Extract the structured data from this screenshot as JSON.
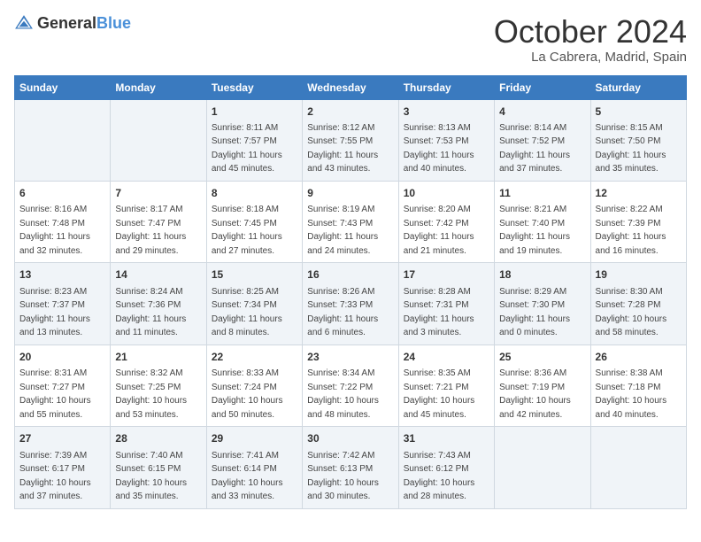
{
  "header": {
    "logo_general": "General",
    "logo_blue": "Blue",
    "month": "October 2024",
    "location": "La Cabrera, Madrid, Spain"
  },
  "columns": [
    "Sunday",
    "Monday",
    "Tuesday",
    "Wednesday",
    "Thursday",
    "Friday",
    "Saturday"
  ],
  "weeks": [
    [
      {
        "day": "",
        "detail": ""
      },
      {
        "day": "",
        "detail": ""
      },
      {
        "day": "1",
        "detail": "Sunrise: 8:11 AM\nSunset: 7:57 PM\nDaylight: 11 hours and 45 minutes."
      },
      {
        "day": "2",
        "detail": "Sunrise: 8:12 AM\nSunset: 7:55 PM\nDaylight: 11 hours and 43 minutes."
      },
      {
        "day": "3",
        "detail": "Sunrise: 8:13 AM\nSunset: 7:53 PM\nDaylight: 11 hours and 40 minutes."
      },
      {
        "day": "4",
        "detail": "Sunrise: 8:14 AM\nSunset: 7:52 PM\nDaylight: 11 hours and 37 minutes."
      },
      {
        "day": "5",
        "detail": "Sunrise: 8:15 AM\nSunset: 7:50 PM\nDaylight: 11 hours and 35 minutes."
      }
    ],
    [
      {
        "day": "6",
        "detail": "Sunrise: 8:16 AM\nSunset: 7:48 PM\nDaylight: 11 hours and 32 minutes."
      },
      {
        "day": "7",
        "detail": "Sunrise: 8:17 AM\nSunset: 7:47 PM\nDaylight: 11 hours and 29 minutes."
      },
      {
        "day": "8",
        "detail": "Sunrise: 8:18 AM\nSunset: 7:45 PM\nDaylight: 11 hours and 27 minutes."
      },
      {
        "day": "9",
        "detail": "Sunrise: 8:19 AM\nSunset: 7:43 PM\nDaylight: 11 hours and 24 minutes."
      },
      {
        "day": "10",
        "detail": "Sunrise: 8:20 AM\nSunset: 7:42 PM\nDaylight: 11 hours and 21 minutes."
      },
      {
        "day": "11",
        "detail": "Sunrise: 8:21 AM\nSunset: 7:40 PM\nDaylight: 11 hours and 19 minutes."
      },
      {
        "day": "12",
        "detail": "Sunrise: 8:22 AM\nSunset: 7:39 PM\nDaylight: 11 hours and 16 minutes."
      }
    ],
    [
      {
        "day": "13",
        "detail": "Sunrise: 8:23 AM\nSunset: 7:37 PM\nDaylight: 11 hours and 13 minutes."
      },
      {
        "day": "14",
        "detail": "Sunrise: 8:24 AM\nSunset: 7:36 PM\nDaylight: 11 hours and 11 minutes."
      },
      {
        "day": "15",
        "detail": "Sunrise: 8:25 AM\nSunset: 7:34 PM\nDaylight: 11 hours and 8 minutes."
      },
      {
        "day": "16",
        "detail": "Sunrise: 8:26 AM\nSunset: 7:33 PM\nDaylight: 11 hours and 6 minutes."
      },
      {
        "day": "17",
        "detail": "Sunrise: 8:28 AM\nSunset: 7:31 PM\nDaylight: 11 hours and 3 minutes."
      },
      {
        "day": "18",
        "detail": "Sunrise: 8:29 AM\nSunset: 7:30 PM\nDaylight: 11 hours and 0 minutes."
      },
      {
        "day": "19",
        "detail": "Sunrise: 8:30 AM\nSunset: 7:28 PM\nDaylight: 10 hours and 58 minutes."
      }
    ],
    [
      {
        "day": "20",
        "detail": "Sunrise: 8:31 AM\nSunset: 7:27 PM\nDaylight: 10 hours and 55 minutes."
      },
      {
        "day": "21",
        "detail": "Sunrise: 8:32 AM\nSunset: 7:25 PM\nDaylight: 10 hours and 53 minutes."
      },
      {
        "day": "22",
        "detail": "Sunrise: 8:33 AM\nSunset: 7:24 PM\nDaylight: 10 hours and 50 minutes."
      },
      {
        "day": "23",
        "detail": "Sunrise: 8:34 AM\nSunset: 7:22 PM\nDaylight: 10 hours and 48 minutes."
      },
      {
        "day": "24",
        "detail": "Sunrise: 8:35 AM\nSunset: 7:21 PM\nDaylight: 10 hours and 45 minutes."
      },
      {
        "day": "25",
        "detail": "Sunrise: 8:36 AM\nSunset: 7:19 PM\nDaylight: 10 hours and 42 minutes."
      },
      {
        "day": "26",
        "detail": "Sunrise: 8:38 AM\nSunset: 7:18 PM\nDaylight: 10 hours and 40 minutes."
      }
    ],
    [
      {
        "day": "27",
        "detail": "Sunrise: 7:39 AM\nSunset: 6:17 PM\nDaylight: 10 hours and 37 minutes."
      },
      {
        "day": "28",
        "detail": "Sunrise: 7:40 AM\nSunset: 6:15 PM\nDaylight: 10 hours and 35 minutes."
      },
      {
        "day": "29",
        "detail": "Sunrise: 7:41 AM\nSunset: 6:14 PM\nDaylight: 10 hours and 33 minutes."
      },
      {
        "day": "30",
        "detail": "Sunrise: 7:42 AM\nSunset: 6:13 PM\nDaylight: 10 hours and 30 minutes."
      },
      {
        "day": "31",
        "detail": "Sunrise: 7:43 AM\nSunset: 6:12 PM\nDaylight: 10 hours and 28 minutes."
      },
      {
        "day": "",
        "detail": ""
      },
      {
        "day": "",
        "detail": ""
      }
    ]
  ]
}
